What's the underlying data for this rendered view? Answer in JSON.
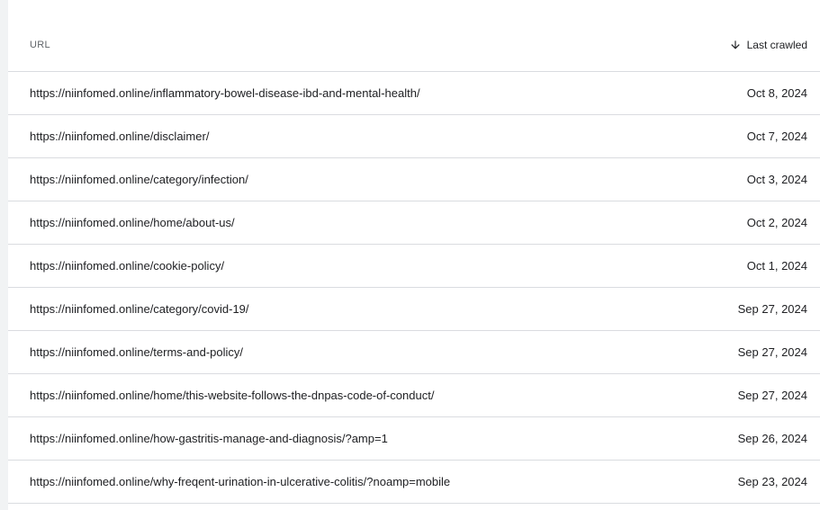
{
  "table": {
    "headers": {
      "url": "URL",
      "last_crawled": "Last crawled",
      "sort_icon": "arrow-down-icon"
    },
    "rows": [
      {
        "url": "https://niinfomed.online/inflammatory-bowel-disease-ibd-and-mental-health/",
        "date": "Oct 8, 2024"
      },
      {
        "url": "https://niinfomed.online/disclaimer/",
        "date": "Oct 7, 2024"
      },
      {
        "url": "https://niinfomed.online/category/infection/",
        "date": "Oct 3, 2024"
      },
      {
        "url": "https://niinfomed.online/home/about-us/",
        "date": "Oct 2, 2024"
      },
      {
        "url": "https://niinfomed.online/cookie-policy/",
        "date": "Oct 1, 2024"
      },
      {
        "url": "https://niinfomed.online/category/covid-19/",
        "date": "Sep 27, 2024"
      },
      {
        "url": "https://niinfomed.online/terms-and-policy/",
        "date": "Sep 27, 2024"
      },
      {
        "url": "https://niinfomed.online/home/this-website-follows-the-dnpas-code-of-conduct/",
        "date": "Sep 27, 2024"
      },
      {
        "url": "https://niinfomed.online/how-gastritis-manage-and-diagnosis/?amp=1",
        "date": "Sep 26, 2024"
      },
      {
        "url": "https://niinfomed.online/why-freqent-urination-in-ulcerative-colitis/?noamp=mobile",
        "date": "Sep 23, 2024"
      }
    ]
  }
}
